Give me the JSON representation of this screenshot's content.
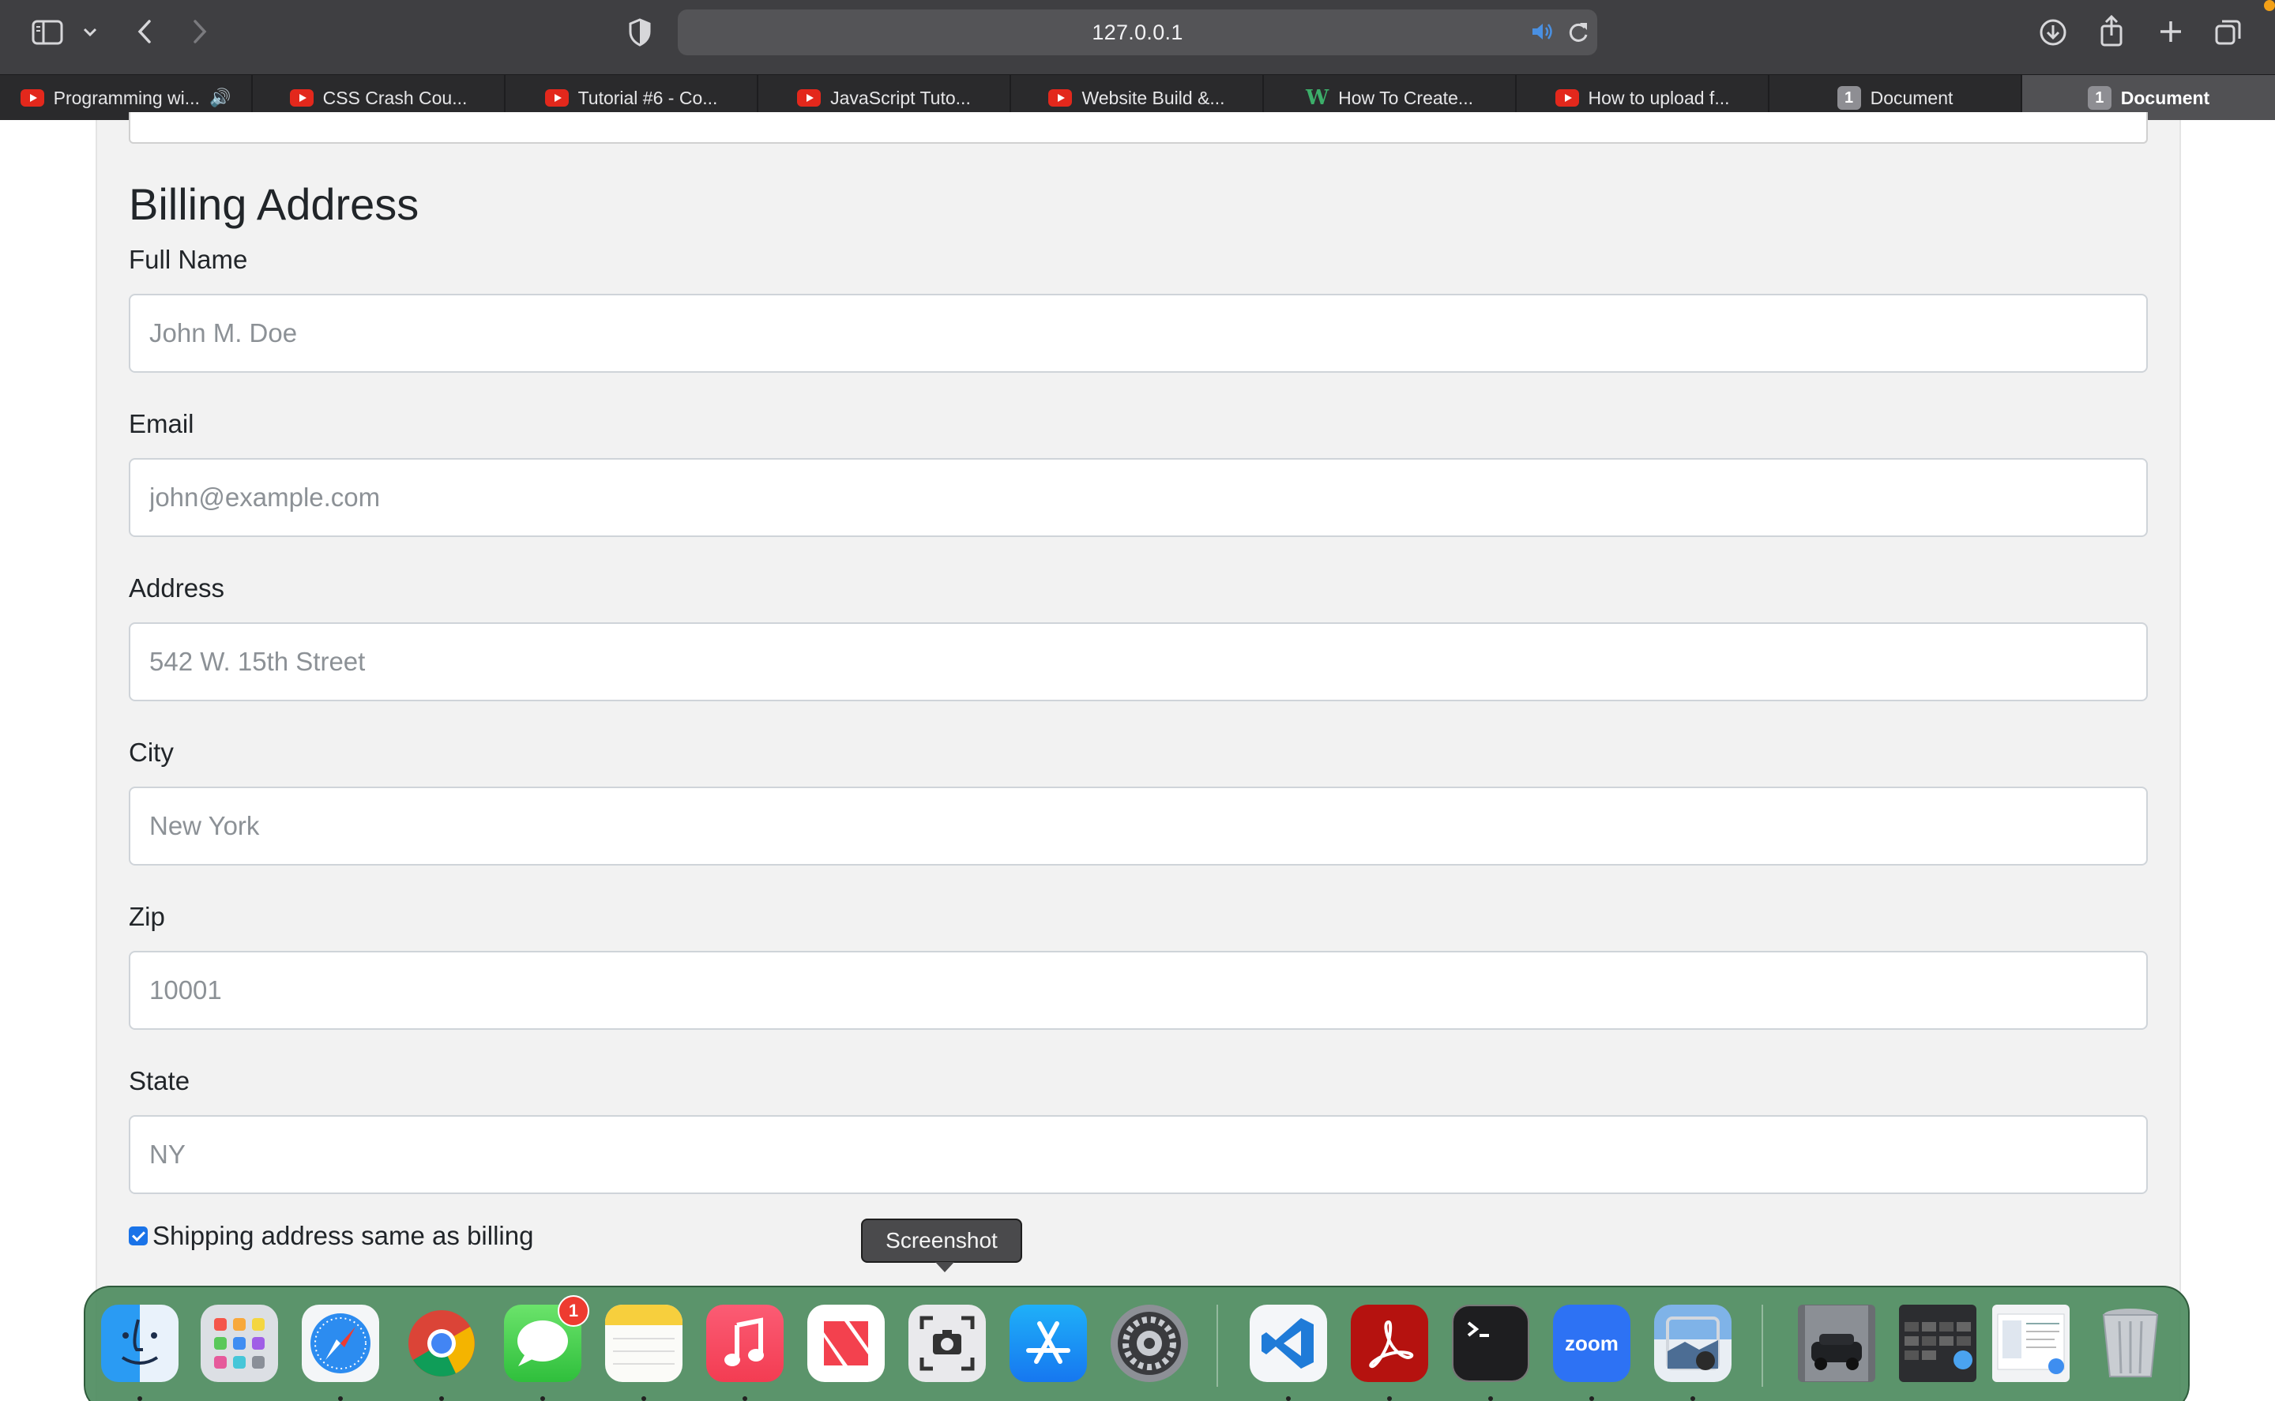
{
  "browser": {
    "url": "127.0.0.1",
    "tabs": [
      {
        "title": "Programming wi...",
        "favicon": "youtube-icon",
        "audio": true
      },
      {
        "title": "CSS Crash Cou...",
        "favicon": "youtube-icon"
      },
      {
        "title": "Tutorial #6 - Co...",
        "favicon": "youtube-icon"
      },
      {
        "title": "JavaScript Tuto...",
        "favicon": "youtube-icon"
      },
      {
        "title": "Website Build &...",
        "favicon": "youtube-icon"
      },
      {
        "title": "How To Create...",
        "favicon": "w3-icon"
      },
      {
        "title": "How to upload f...",
        "favicon": "youtube-icon"
      },
      {
        "title": "Document",
        "favicon": "number-one-icon"
      },
      {
        "title": "Document",
        "favicon": "number-one-icon",
        "active": true
      }
    ],
    "tab_badge": "1",
    "tab_w_glyph": "W"
  },
  "form": {
    "section_title": "Billing Address",
    "fields": [
      {
        "label": "Full Name",
        "placeholder": "John M. Doe"
      },
      {
        "label": "Email",
        "placeholder": "john@example.com"
      },
      {
        "label": "Address",
        "placeholder": "542 W. 15th Street"
      },
      {
        "label": "City",
        "placeholder": "New York"
      },
      {
        "label": "Zip",
        "placeholder": "10001"
      },
      {
        "label": "State",
        "placeholder": "NY"
      }
    ],
    "checkbox_label": "Shipping address same as billing",
    "checkbox_checked": true
  },
  "tooltip": "Screenshot",
  "dock": {
    "messages_badge": "1",
    "zoom_label": "zoom",
    "apps": [
      "finder-icon",
      "launchpad-icon",
      "safari-icon",
      "chrome-icon",
      "messages-icon",
      "notes-icon",
      "music-icon",
      "news-icon",
      "screenshot-icon",
      "app-store-icon",
      "system-settings-icon",
      "vscode-icon",
      "acrobat-icon",
      "terminal-icon",
      "zoom-icon",
      "preview-icon",
      "photo-thumbnail",
      "folder-stack",
      "document-stack",
      "trash-icon"
    ]
  },
  "colors": {
    "toolbar": "#3f3f42",
    "tabstrip": "#2a2a2c",
    "active_tab": "#515154",
    "content_bg": "#f2f2f2",
    "checkbox": "#1a73e8",
    "dock": "#4e8c60"
  }
}
